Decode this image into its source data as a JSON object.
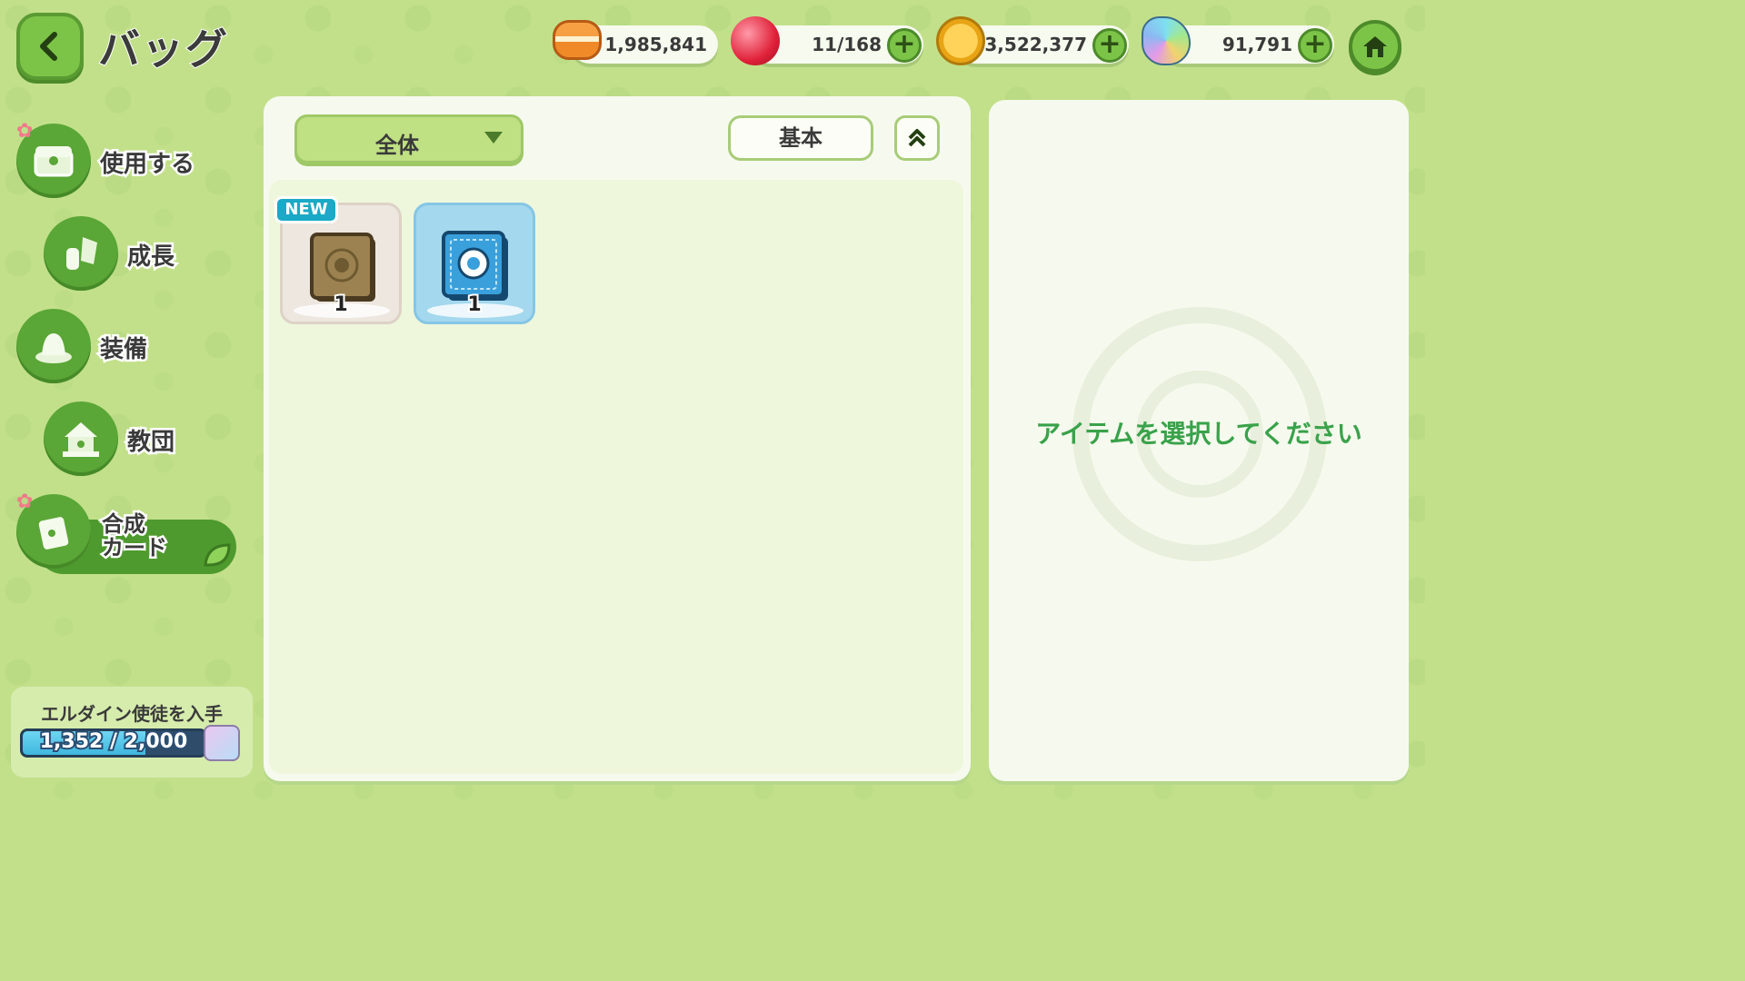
{
  "header": {
    "title": "バッグ",
    "resources": [
      {
        "icon": "orange-macaron-icon",
        "value": "1,985,841",
        "has_plus": false
      },
      {
        "icon": "red-candy-icon",
        "value": "11/168",
        "has_plus": true
      },
      {
        "icon": "gold-leaf-coin-icon",
        "value": "3,522,377",
        "has_plus": true
      },
      {
        "icon": "rainbow-crystal-leaf-icon",
        "value": "91,791",
        "has_plus": true
      }
    ],
    "plus_label": "+"
  },
  "sidebar": {
    "items": [
      {
        "label": "使用する",
        "icon": "treasure-chest-icon",
        "badge": true
      },
      {
        "label": "成長",
        "icon": "crystal-bottle-icon",
        "badge": false
      },
      {
        "label": "装備",
        "icon": "hat-icon",
        "badge": false
      },
      {
        "label": "教団",
        "icon": "temple-icon",
        "badge": false
      },
      {
        "label_line1": "合成",
        "label_line2": "カード",
        "icon": "card-icon",
        "badge": true,
        "active": true
      }
    ],
    "badge_glyph": "✿"
  },
  "filter": {
    "dropdown_value": "全体",
    "sort_label": "基本"
  },
  "items": [
    {
      "name": "brown-card-pack",
      "count": "1",
      "is_new": true,
      "new_label": "NEW"
    },
    {
      "name": "blue-card-pack",
      "count": "1",
      "is_new": false
    }
  ],
  "detail": {
    "empty_message": "アイテムを選択してください"
  },
  "progress": {
    "title": "エルダイン使徒を入手",
    "current": 1352,
    "max": 2000,
    "text": "1,352 / 2,000",
    "fill_fraction": 0.676
  },
  "colors": {
    "background": "#c2e08a",
    "accent_green": "#7cc447",
    "message_green": "#39a24a",
    "new_badge": "#1aa9c6"
  }
}
